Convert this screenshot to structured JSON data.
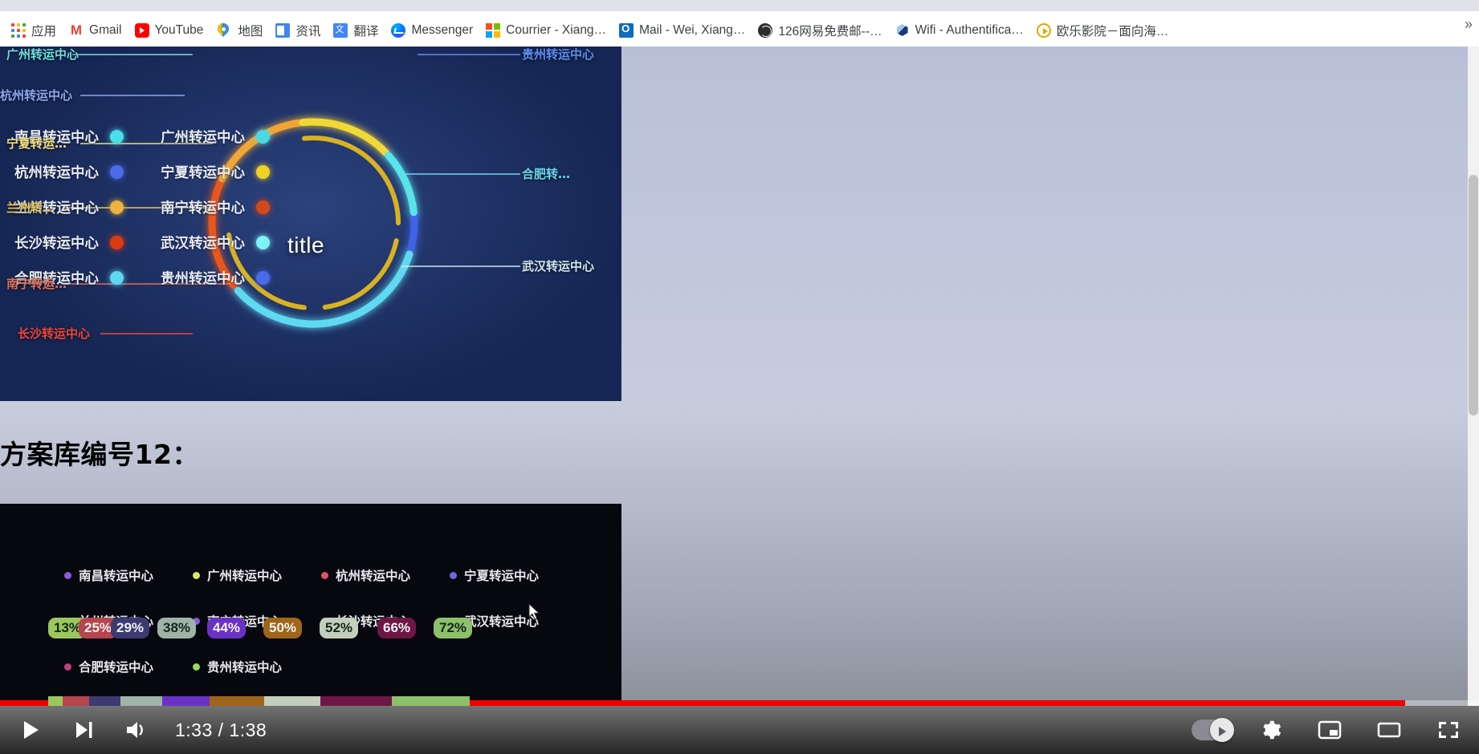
{
  "browser": {
    "bookmarks": [
      {
        "label": "应用",
        "icon": "apps-grid-icon"
      },
      {
        "label": "Gmail",
        "icon": "gmail-icon"
      },
      {
        "label": "YouTube",
        "icon": "youtube-icon"
      },
      {
        "label": "地图",
        "icon": "google-maps-icon"
      },
      {
        "label": "资讯",
        "icon": "google-news-icon"
      },
      {
        "label": "翻译",
        "icon": "google-translate-icon"
      },
      {
        "label": "Messenger",
        "icon": "messenger-icon"
      },
      {
        "label": "Courrier - Xiang…",
        "icon": "microsoft-icon"
      },
      {
        "label": "Mail - Wei, Xiang…",
        "icon": "outlook-icon"
      },
      {
        "label": "126网易免费邮--…",
        "icon": "globe-icon"
      },
      {
        "label": "Wifi - Authentifica…",
        "icon": "cube-icon"
      },
      {
        "label": "欧乐影院－面向海…",
        "icon": "play-circle-icon"
      }
    ],
    "overflow_label": "»"
  },
  "slide": {
    "caption": "方案库编号12："
  },
  "chart_data": [
    {
      "type": "pie",
      "chart_style": "dual-ring donut",
      "title": "title",
      "legend_position": "left, two columns",
      "legend_left_column": [
        {
          "label": "南昌转运中心",
          "color": "#47e0e8"
        },
        {
          "label": "杭州转运中心",
          "color": "#4a6ae8"
        },
        {
          "label": "兰州转运中心",
          "color": "#edb33b"
        },
        {
          "label": "长沙转运中心",
          "color": "#dd3a12"
        },
        {
          "label": "合肥转运中心",
          "color": "#5ed8ee"
        }
      ],
      "legend_right_column": [
        {
          "label": "广州转运中心",
          "color": "#4ad9e4"
        },
        {
          "label": "宁夏转运中心",
          "color": "#f0d224"
        },
        {
          "label": "南宁转运中心",
          "color": "#d4491c"
        },
        {
          "label": "武汉转运中心",
          "color": "#7df2f7"
        },
        {
          "label": "贵州转运中心",
          "color": "#4a6ae8"
        }
      ],
      "callouts": [
        {
          "label": "广州转运中心",
          "color": "#6fe0d8",
          "side": "left"
        },
        {
          "label": "杭州转运中心",
          "color": "#8fa8ee",
          "side": "left"
        },
        {
          "label": "宁夏转运…",
          "color": "#efe07a",
          "side": "left"
        },
        {
          "label": "兰州转…",
          "color": "#e9c85e",
          "side": "left"
        },
        {
          "label": "南宁转运…",
          "color": "#e0705a",
          "side": "left"
        },
        {
          "label": "长沙转运中心",
          "color": "#f0453a",
          "side": "left"
        },
        {
          "label": "贵州转运中心",
          "color": "#5c8ff0",
          "side": "right"
        },
        {
          "label": "合肥转…",
          "color": "#6fd8ee",
          "side": "right"
        },
        {
          "label": "武汉转运中心",
          "color": "#cfe6ef",
          "side": "right"
        }
      ],
      "outer_ring_segments": [
        {
          "name": "贵州转运中心",
          "color": "#3f63e6",
          "start_deg": -88,
          "sweep_deg": 104
        },
        {
          "name": "合肥转运中心",
          "color": "#5fd9f2",
          "start_deg": 18,
          "sweep_deg": 120
        },
        {
          "name": "长沙转运中心",
          "color": "#e8561c",
          "start_deg": 142,
          "sweep_deg": 62
        },
        {
          "name": "南宁转运中心",
          "color": "#f0a534",
          "start_deg": 206,
          "sweep_deg": 56
        },
        {
          "name": "宁夏转运中心",
          "color": "#f3d835",
          "start_deg": 264,
          "sweep_deg": 52
        },
        {
          "name": "广州转运中心",
          "color": "#58e4e8",
          "start_deg": 318,
          "sweep_deg": 36
        }
      ],
      "inner_ring_segments": [
        {
          "name": "ring-b-1",
          "color": "#d9b221",
          "start_deg": -96,
          "sweep_deg": 96
        },
        {
          "name": "ring-b-2",
          "color": "#d9b221",
          "start_deg": 12,
          "sweep_deg": 70
        },
        {
          "name": "ring-b-3",
          "color": "#d9b221",
          "start_deg": 96,
          "sweep_deg": 76
        }
      ]
    },
    {
      "type": "bar",
      "chart_style": "horizontal stacked percentage bar",
      "categories": [
        "南昌转运中心",
        "广州转运中心",
        "杭州转运中心",
        "宁夏转运中心",
        "兰州转运中心",
        "南宁转运中心",
        "长沙转运中心",
        "合肥转运中心",
        "贵州转运中心"
      ],
      "values": [
        13,
        25,
        29,
        38,
        44,
        50,
        52,
        66,
        72
      ],
      "value_labels": [
        "13%",
        "25%",
        "29%",
        "38%",
        "44%",
        "50%",
        "52%",
        "66%",
        "72%"
      ],
      "segment_colors": [
        "#9bc75e",
        "#b5454f",
        "#3c3a72",
        "#9fb3a8",
        "#6a32c4",
        "#a0651a",
        "#c2cfbc",
        "#6e1646",
        "#8dc06a"
      ],
      "legend_row1": [
        {
          "label": "南昌转运中心",
          "color": "#8a5ad8"
        },
        {
          "label": "广州转运中心",
          "color": "#d8e86a"
        },
        {
          "label": "杭州转运中心",
          "color": "#e0506a"
        },
        {
          "label": "宁夏转运中心",
          "color": "#6a6ae0"
        }
      ],
      "legend_row2": [
        {
          "label": "兰州转运中心",
          "color": "#58d0b8"
        },
        {
          "label": "南宁转运中心",
          "color": "#8a5ad8"
        },
        {
          "label": "长沙转运中心",
          "color": "#c08a52"
        },
        {
          "label": "武汉转运中心",
          "color": "#ffffff"
        }
      ],
      "legend_row3": [
        {
          "label": "合肥转运中心",
          "color": "#c0407a"
        },
        {
          "label": "贵州转运中心",
          "color": "#9bd858"
        }
      ],
      "xlabel": "",
      "ylabel": "",
      "grid": false
    }
  ],
  "player": {
    "play_label": "▶",
    "next_label": "▶|",
    "time_current": "1:33",
    "time_total": "1:38",
    "time_display": "1:33 / 1:38",
    "progress_percent": 95,
    "autoplay_label": "autoplay-toggle",
    "settings_label": "settings-gear",
    "miniplayer_label": "miniplayer",
    "theater_label": "theater-mode",
    "fullscreen_label": "fullscreen"
  }
}
